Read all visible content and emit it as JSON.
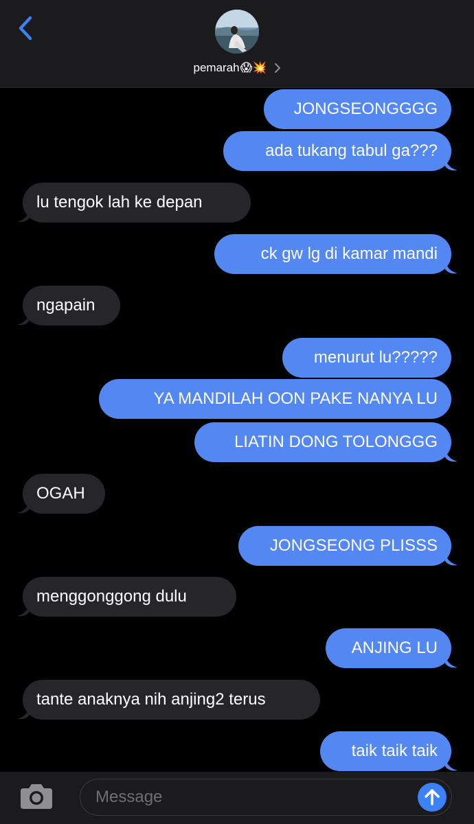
{
  "header": {
    "contact_name": "pemarah",
    "contact_emoji": "😱💥",
    "avatar_icon": "profile-photo",
    "back_icon": "chevron-left-icon",
    "accent_color": "#3b82f6"
  },
  "messages": [
    {
      "direction": "outgoing",
      "text": "JONGSEONGGGG"
    },
    {
      "direction": "outgoing",
      "text": "ada tukang tabul ga???"
    },
    {
      "direction": "incoming",
      "text": "lu tengok lah ke depan"
    },
    {
      "direction": "outgoing",
      "text": "ck gw lg di kamar mandi"
    },
    {
      "direction": "incoming",
      "text": "ngapain"
    },
    {
      "direction": "outgoing",
      "text": "menurut lu?????"
    },
    {
      "direction": "outgoing",
      "text": "YA MANDILAH OON PAKE NANYA LU"
    },
    {
      "direction": "outgoing",
      "text": "LIATIN DONG TOLONGGG"
    },
    {
      "direction": "incoming",
      "text": "OGAH"
    },
    {
      "direction": "outgoing",
      "text": "JONGSEONG PLISSS"
    },
    {
      "direction": "incoming",
      "text": "menggonggong dulu"
    },
    {
      "direction": "outgoing",
      "text": "ANJING LU"
    },
    {
      "direction": "incoming",
      "text": "tante anaknya nih anjing2 terus"
    },
    {
      "direction": "outgoing",
      "text": "taik taik taik"
    }
  ],
  "compose": {
    "placeholder": "Message",
    "camera_icon": "camera-icon",
    "send_icon": "arrow-up-icon"
  },
  "colors": {
    "outgoing_bubble": "#5387f2",
    "incoming_bubble": "#262628",
    "background": "#000000"
  }
}
